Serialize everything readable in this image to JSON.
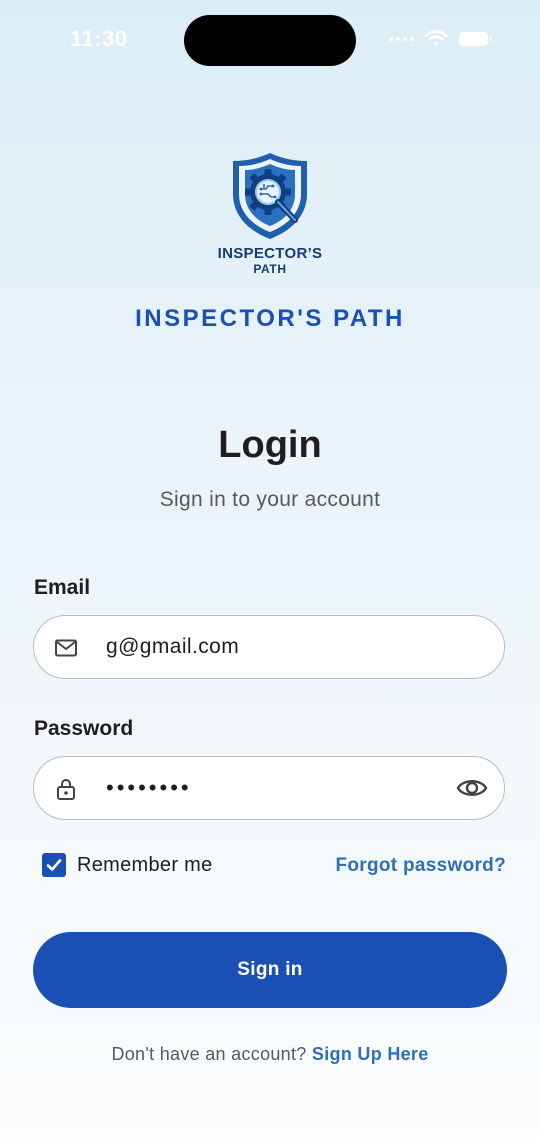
{
  "status_bar": {
    "time": "11:30"
  },
  "logo": {
    "line1": "INSPECTOR’S",
    "line2": "PATH"
  },
  "brand": {
    "title": "INSPECTOR'S PATH"
  },
  "header": {
    "title": "Login",
    "subtitle": "Sign in to your account"
  },
  "form": {
    "email": {
      "label": "Email",
      "value": "g@gmail.com",
      "icon": "mail-icon"
    },
    "password": {
      "label": "Password",
      "value": "••••••••",
      "icon": "lock-icon",
      "toggle_icon": "eye-icon"
    },
    "remember": {
      "label": "Remember me",
      "checked": true
    },
    "forgot_label": "Forgot password?",
    "submit_label": "Sign in"
  },
  "footer": {
    "prompt": "Don't have an account?",
    "link": "Sign Up Here"
  },
  "colors": {
    "primary": "#1a50b3",
    "link": "#2f6fb5",
    "text": "#1e1e1e",
    "muted": "#555a5f"
  }
}
